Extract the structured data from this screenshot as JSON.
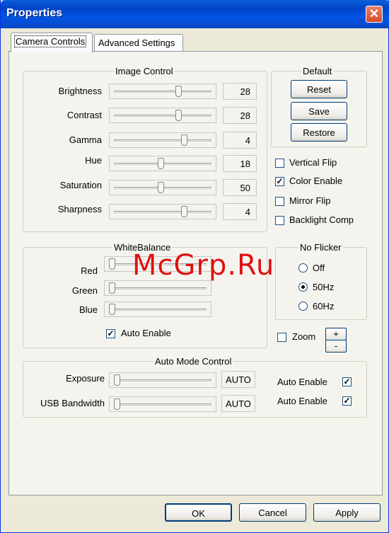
{
  "window": {
    "title": "Properties"
  },
  "tabs": [
    "Camera Controls",
    "Advanced Settings"
  ],
  "image_control": {
    "title": "Image Control",
    "rows": [
      {
        "label": "Brightness",
        "value": "28",
        "level": 0.66
      },
      {
        "label": "Contrast",
        "value": "28",
        "level": 0.66
      },
      {
        "label": "Gamma",
        "value": "4",
        "level": 0.72
      },
      {
        "label": "Hue",
        "value": "18",
        "level": 0.48
      },
      {
        "label": "Saturation",
        "value": "50",
        "level": 0.48
      },
      {
        "label": "Sharpness",
        "value": "4",
        "level": 0.72
      }
    ]
  },
  "default": {
    "title": "Default",
    "buttons": [
      "Reset",
      "Save",
      "Restore"
    ]
  },
  "toggles": [
    {
      "label": "Vertical Flip",
      "checked": false
    },
    {
      "label": "Color Enable",
      "checked": true
    },
    {
      "label": "Mirror Flip",
      "checked": false
    },
    {
      "label": "Backlight Comp",
      "checked": false
    }
  ],
  "white_balance": {
    "title": "WhiteBalance",
    "rows": [
      {
        "label": "Red",
        "level": 0.02
      },
      {
        "label": "Green",
        "level": 0.02
      },
      {
        "label": "Blue",
        "level": 0.02
      }
    ],
    "auto_enable": {
      "label": "Auto Enable",
      "checked": true
    }
  },
  "no_flicker": {
    "title": "No Flicker",
    "options": [
      {
        "label": "Off",
        "selected": false
      },
      {
        "label": "50Hz",
        "selected": true
      },
      {
        "label": "60Hz",
        "selected": false
      }
    ]
  },
  "zoom": {
    "label": "Zoom",
    "checked": false,
    "plus": "+",
    "minus": "-"
  },
  "auto_mode": {
    "title": "Auto Mode Control",
    "rows": [
      {
        "label": "Exposure",
        "value": "AUTO",
        "level": 0.02,
        "auto_label": "Auto Enable",
        "checked": true
      },
      {
        "label": "USB Bandwidth",
        "value": "AUTO",
        "level": 0.02,
        "auto_label": "Auto Enable",
        "checked": true
      }
    ]
  },
  "footer": {
    "ok": "OK",
    "cancel": "Cancel",
    "apply": "Apply"
  },
  "watermark": "McGrp.Ru"
}
